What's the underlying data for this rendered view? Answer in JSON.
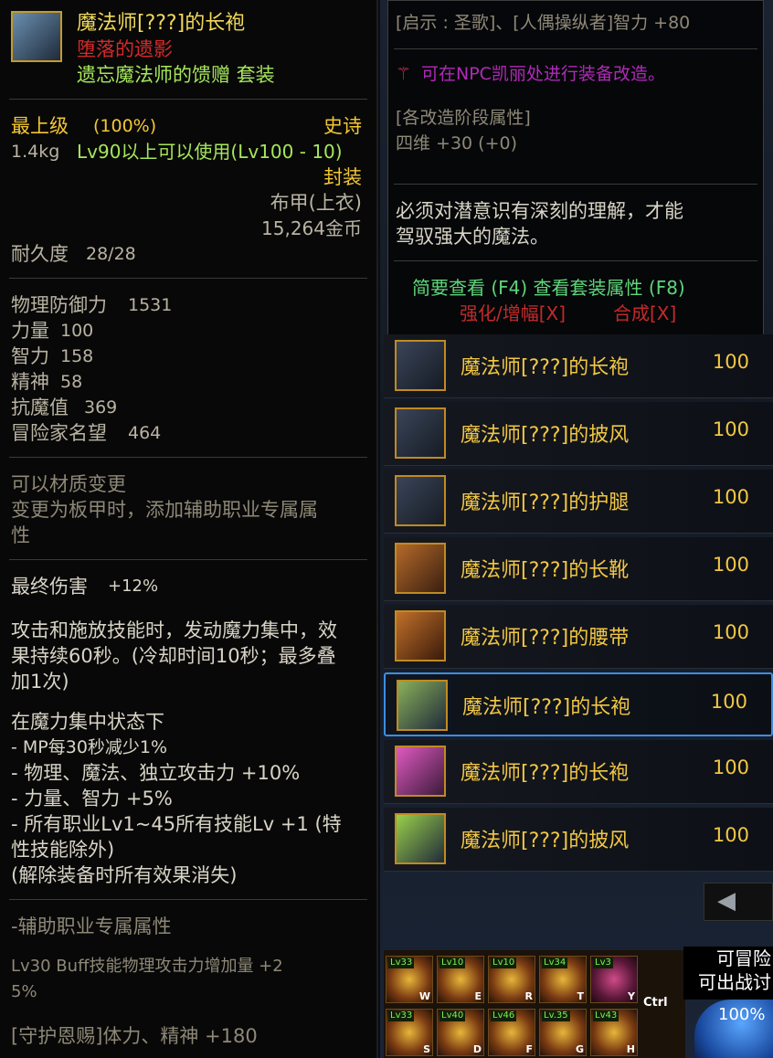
{
  "tooltip": {
    "item_name": "魔法师[???]的长袍",
    "subtitle": "堕落的遗影",
    "set_name": "遗忘魔法师的馈赠   套装",
    "grade": "最上级",
    "grade_pct": "(100%)",
    "rarity": "史诗",
    "weight": "1.4kg",
    "level_req": "Lv90以上可以使用(Lv100 - 10)",
    "bind": "封装",
    "slot": "布甲(上衣)",
    "price": "15,264金币",
    "durability_label": "耐久度",
    "durability_value": "28/28",
    "stats": [
      {
        "label": "物理防御力",
        "value": "1531"
      },
      {
        "label": "力量",
        "value": "100"
      },
      {
        "label": "智力",
        "value": "158"
      },
      {
        "label": "精神",
        "value": "58"
      },
      {
        "label": "抗魔值",
        "value": "369"
      },
      {
        "label": "冒险家名望",
        "value": "464"
      }
    ],
    "material_change": "可以材质变更",
    "material_desc_1": "变更为板甲时，添加辅助职业专属属",
    "material_desc_2": "性",
    "final_damage_label": "最终伤害",
    "final_damage_value": "+12%",
    "effect_1": "攻击和施放技能时，发动魔力集中，效",
    "effect_2": "果持续60秒。(冷却时间10秒；最多叠",
    "effect_3": "加1次)",
    "state_title": "在魔力集中状态下",
    "state_lines": [
      "- MP每30秒减少1%",
      "- 物理、魔法、独立攻击力 +10%",
      "- 力量、智力 +5%",
      "- 所有职业Lv1~45所有技能Lv +1 (特",
      "性技能除外)",
      "(解除装备时所有效果消失)"
    ],
    "support_title": "-辅助职业专属属性",
    "support_line_1": "Lv30 Buff技能物理攻击力增加量 +2",
    "support_line_2": "5%",
    "guard_line": "[守护恩赐]体力、精神 +180"
  },
  "info_box": {
    "hint": "[启示 : 圣歌]、[人偶操纵者]智力 +80",
    "npc_line": "可在NPC凯丽处进行装备改造。",
    "upgrade_title": "[各改造阶段属性]",
    "upgrade_stat": "四维 +30 (+0)",
    "flavor_1": "必须对潜意识有深刻的理解，才能",
    "flavor_2": "驾驭强大的魔法。",
    "quick_view": "简要查看 (F4) 查看套装属性 (F8)",
    "reinforce": "强化/增幅[X]",
    "synth": "合成[X]"
  },
  "list": [
    {
      "name": "魔法师[???]的长袍",
      "value": "100"
    },
    {
      "name": "魔法师[???]的披风",
      "value": "100"
    },
    {
      "name": "魔法师[???]的护腿",
      "value": "100"
    },
    {
      "name": "魔法师[???]的长靴",
      "value": "100"
    },
    {
      "name": "魔法师[???]的腰带",
      "value": "100"
    },
    {
      "name": "魔法师[???]的长袍",
      "value": "100"
    },
    {
      "name": "魔法师[???]的长袍",
      "value": "100"
    },
    {
      "name": "魔法师[???]的披风",
      "value": "100"
    }
  ],
  "skills": [
    {
      "lv": "Lv33",
      "key": "W"
    },
    {
      "lv": "Lv10",
      "key": "E"
    },
    {
      "lv": "Lv10",
      "key": "R"
    },
    {
      "lv": "Lv34",
      "key": "T"
    },
    {
      "lv": "Lv3",
      "key": "Y"
    },
    {
      "lv": "Lv33",
      "key": "S"
    },
    {
      "lv": "Lv40",
      "key": "D"
    },
    {
      "lv": "Lv46",
      "key": "F"
    },
    {
      "lv": "Lv.35",
      "key": "G"
    },
    {
      "lv": "Lv43",
      "key": "H"
    }
  ],
  "ctrl_label": "Ctrl",
  "notice_1": "可冒险",
  "notice_2": "可出战讨",
  "orb_pct": "100%",
  "arrow": "◀"
}
